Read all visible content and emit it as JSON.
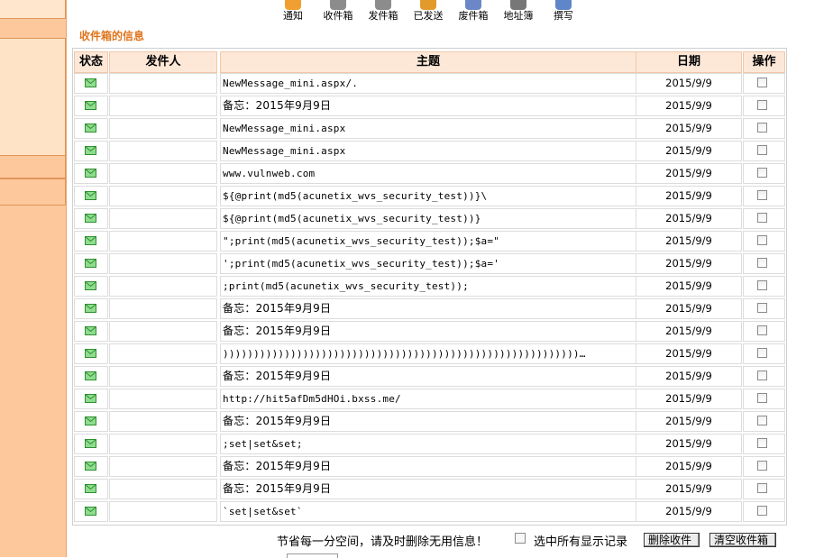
{
  "toolbar": {
    "items": [
      {
        "label": "通知",
        "icon": "notice-icon",
        "color": "#f0a030"
      },
      {
        "label": "收件箱",
        "icon": "inbox-icon",
        "color": "#8c8c8c"
      },
      {
        "label": "发件箱",
        "icon": "outbox-icon",
        "color": "#8c8c8c"
      },
      {
        "label": "已发送",
        "icon": "sent-icon",
        "color": "#e29a2a"
      },
      {
        "label": "废件箱",
        "icon": "trash-icon",
        "color": "#6b87c7"
      },
      {
        "label": "地址簿",
        "icon": "address-book-icon",
        "color": "#777777"
      },
      {
        "label": "撰写",
        "icon": "compose-icon",
        "color": "#5f86c9"
      }
    ]
  },
  "page": {
    "title": "收件箱的信息"
  },
  "table": {
    "headers": {
      "status": "状态",
      "sender": "发件人",
      "subject": "主题",
      "date": "日期",
      "action": "操作"
    },
    "rows": [
      {
        "sender": "",
        "subject": "NewMessage_mini.aspx/.",
        "date": "2015/9/9"
      },
      {
        "sender": "",
        "subject": "备忘：2015年9月9日",
        "date": "2015/9/9"
      },
      {
        "sender": "",
        "subject": "NewMessage_mini.aspx",
        "date": "2015/9/9"
      },
      {
        "sender": "",
        "subject": "NewMessage_mini.aspx",
        "date": "2015/9/9"
      },
      {
        "sender": "",
        "subject": "www.vulnweb.com",
        "date": "2015/9/9"
      },
      {
        "sender": "",
        "subject": "${@print(md5(acunetix_wvs_security_test))}\\",
        "date": "2015/9/9"
      },
      {
        "sender": "",
        "subject": "${@print(md5(acunetix_wvs_security_test))}",
        "date": "2015/9/9"
      },
      {
        "sender": "",
        "subject": "\";print(md5(acunetix_wvs_security_test));$a=\"",
        "date": "2015/9/9"
      },
      {
        "sender": "",
        "subject": "';print(md5(acunetix_wvs_security_test));$a='",
        "date": "2015/9/9"
      },
      {
        "sender": "",
        "subject": ";print(md5(acunetix_wvs_security_test));",
        "date": "2015/9/9"
      },
      {
        "sender": "",
        "subject": "备忘：2015年9月9日",
        "date": "2015/9/9"
      },
      {
        "sender": "",
        "subject": "备忘：2015年9月9日",
        "date": "2015/9/9"
      },
      {
        "sender": "",
        "subject": "))))))))))))))))))))))))))))))))))))))))))))))))))))))))))…",
        "date": "2015/9/9"
      },
      {
        "sender": "",
        "subject": "备忘：2015年9月9日",
        "date": "2015/9/9"
      },
      {
        "sender": "",
        "subject": "http://hit5afDm5dHOi.bxss.me/",
        "date": "2015/9/9"
      },
      {
        "sender": "",
        "subject": "备忘：2015年9月9日",
        "date": "2015/9/9"
      },
      {
        "sender": "",
        "subject": ";set|set&set;",
        "date": "2015/9/9"
      },
      {
        "sender": "",
        "subject": "备忘：2015年9月9日",
        "date": "2015/9/9"
      },
      {
        "sender": "",
        "subject": "备忘：2015年9月9日",
        "date": "2015/9/9"
      },
      {
        "sender": "",
        "subject": "`set|set&set`",
        "date": "2015/9/9"
      }
    ]
  },
  "footer": {
    "note": "节省每一分空间，请及时删除无用信息！",
    "select_all_label": "选中所有显示记录",
    "delete_button": "删除收件",
    "clear_button": "清空收件箱"
  },
  "colors": {
    "sidebar": "#fdc89b",
    "title": "#e0751d",
    "header_bg": "#fde8d8",
    "envelope": "#4caf50"
  }
}
